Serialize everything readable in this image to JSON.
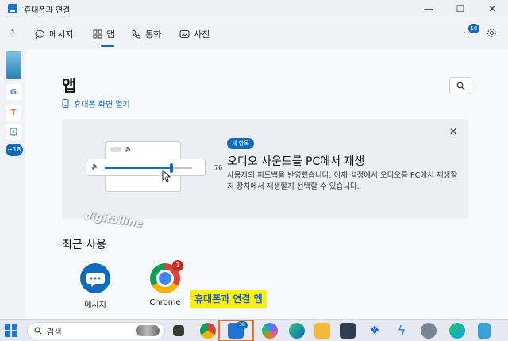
{
  "window": {
    "title": "휴대폰과 연결",
    "icon": "phone-link-icon"
  },
  "nav": {
    "tabs": [
      {
        "label": "메시지",
        "icon": "message-icon"
      },
      {
        "label": "앱",
        "icon": "apps-icon",
        "active": true
      },
      {
        "label": "통화",
        "icon": "phone-icon"
      },
      {
        "label": "사진",
        "icon": "photo-icon"
      }
    ],
    "notification_count": "16"
  },
  "rail": {
    "items": [
      "G",
      "T"
    ],
    "more_count": "+18"
  },
  "main": {
    "title": "앱",
    "open_screen_label": "휴대폰 화면 열기"
  },
  "card": {
    "badge": "새 항목",
    "title": "오디오 사운드를 PC에서 재생",
    "description": "사용자의 피드백을 반영했습니다. 이제 설정에서 오디오를 PC에서 재생할지 장치에서 재생할지 선택할 수 있습니다.",
    "slider_value": "76",
    "slider_fraction": 0.76
  },
  "watermark": "digitalline",
  "recent": {
    "title": "최근 사용",
    "apps": [
      {
        "label": "메시지",
        "icon": "messages-app-icon"
      },
      {
        "label": "Chrome",
        "icon": "chrome-icon",
        "badge": "1"
      }
    ]
  },
  "callout": "휴대폰과 연결 앱",
  "taskbar": {
    "search_placeholder": "검색",
    "phone_link_badge": "38"
  },
  "colors": {
    "accent": "#0f6cbd",
    "callout_bg": "#fff200",
    "highlight": "#e8742c"
  }
}
